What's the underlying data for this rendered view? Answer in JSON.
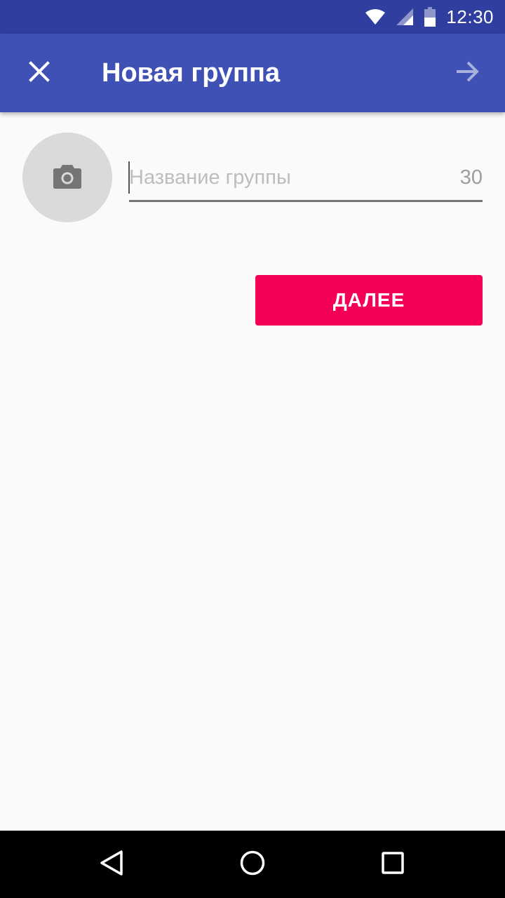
{
  "status_bar": {
    "time": "12:30",
    "icons": [
      "wifi-icon",
      "signal-icon",
      "battery-icon"
    ]
  },
  "app_bar": {
    "title": "Новая группа",
    "close_icon": "close-icon",
    "next_icon": "arrow-forward-icon",
    "color": "#3f51b5"
  },
  "group_form": {
    "photo_icon": "camera-icon",
    "name_placeholder": "Название группы",
    "name_value": "",
    "char_counter": "30"
  },
  "actions": {
    "next_label": "ДАЛЕЕ",
    "accent_color": "#f50057"
  },
  "nav_bar": {
    "icons": [
      "back-icon",
      "home-icon",
      "recents-icon"
    ]
  }
}
